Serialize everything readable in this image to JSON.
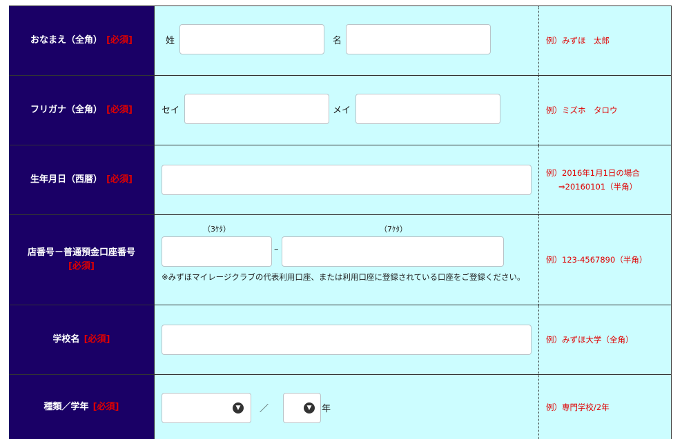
{
  "rows": [
    {
      "label": "おなまえ（全角）",
      "required": "[必須]",
      "sub1_label": "姓",
      "sub1_value": "",
      "sub2_label": "名",
      "sub2_value": "",
      "example": "例）みずほ　太郎"
    },
    {
      "label": "フリガナ（全角）",
      "required": "[必須]",
      "sub1_label": "セイ",
      "sub1_value": "",
      "sub2_label": "メイ",
      "sub2_value": "",
      "example": "例）ミズホ　タロウ"
    },
    {
      "label": "生年月日（西暦）",
      "required": "[必須]",
      "value": "",
      "example_line1": "例）2016年1月1日の場合",
      "example_line2": "⇒20160101（半角）"
    },
    {
      "label": "店番号－普通預金口座番号",
      "required": "[必須]",
      "branch_hint": "（3ｹﾀ）",
      "account_hint": "（7ｹﾀ）",
      "separator": "–",
      "branch_value": "",
      "account_value": "",
      "note": "※みずほマイレージクラブの代表利用口座、または利用口座に登録されている口座をご登録ください。",
      "example": "例）123-4567890（半角）"
    },
    {
      "label": "学校名",
      "required": "[必須]",
      "value": "",
      "example": "例）みずほ大学（全角）"
    },
    {
      "label": "種類／学年",
      "required": "[必須]",
      "type_selected": "",
      "slash": "／",
      "grade_selected": "",
      "grade_suffix": "年",
      "example": "例）専門学校/2年"
    }
  ],
  "colors": {
    "label_bg": "#1a0066",
    "input_bg": "#ccfdff",
    "required": "#e00000"
  },
  "icons": {
    "select_arrow": "chevron-down-icon"
  }
}
